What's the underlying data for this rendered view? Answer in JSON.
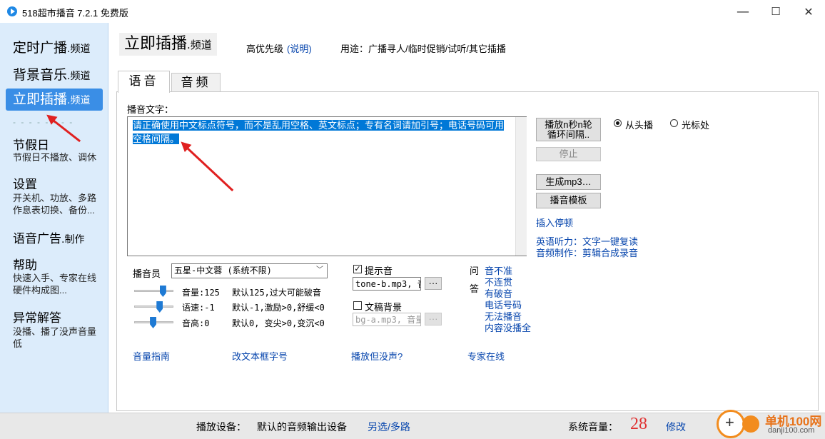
{
  "window": {
    "title": "518超市播音 7.2.1 免费版",
    "minimize_glyph": "—",
    "maximize_glyph": "☐",
    "close_glyph": "✕"
  },
  "sidebar": {
    "scheduled": {
      "main": "定时广播",
      "suffix": ".频道"
    },
    "bgm": {
      "main": "背景音乐",
      "suffix": ".频道"
    },
    "instant": {
      "main": "立即插播",
      "suffix": ".频道"
    },
    "separator": "- - - - - - - -",
    "holiday": {
      "title": "节假日",
      "desc": "节假日不播放、调休"
    },
    "settings": {
      "title": "设置",
      "desc": "开关机、功放、多路作息表切换、备份..."
    },
    "voice_ad": {
      "main": "语音广告",
      "suffix": ".制作"
    },
    "help": {
      "title": "帮助",
      "desc": "快速入手、专家在线硬件构成图..."
    },
    "trouble": {
      "title": "异常解答",
      "desc": "没播、播了没声音量低"
    }
  },
  "header": {
    "title": "立即插播",
    "title_suffix": ".频道",
    "priority": "高优先级",
    "priority_link": "(说明)",
    "usage": "用途：广播寻人/临时促销/试听/其它插播"
  },
  "tabs": [
    {
      "label": "语音"
    },
    {
      "label": "音频"
    }
  ],
  "voice": {
    "text_label": "播音文字：",
    "text_line1": "请正确使用中文标点符号，而不是乱用空格、英文标点；专有名词请加引号；电话号码可用",
    "text_line2": "空格间隔。",
    "loop_button": "播放n秒n轮\n循环间隔..",
    "stop_button": "停止",
    "mp3_button": "生成mp3…",
    "template_button": "播音模板",
    "insert_pause": "插入停顿",
    "radio_start": "从头播",
    "radio_cursor": "光标处",
    "english_link": "英语听力：文字一键复读",
    "audio_link": "音频制作：剪辑合成录音"
  },
  "announcer": {
    "label": "播音员",
    "selected": "五星-中文蓉 (系统不限)",
    "volume_label": "音量:125",
    "volume_hint": "默认125,过大可能破音",
    "speed_label": "语速:-1",
    "speed_hint": "默认-1,激励>0,舒缓<0",
    "pitch_label": "音高:0",
    "pitch_hint": "默认0, 变尖>0,变沉<0",
    "volume_level": 0.78,
    "speed_level": 0.68,
    "pitch_level": 0.48
  },
  "prompt_tone": {
    "label": "提示音",
    "checked": "✓",
    "file": "tone-b.mp3, 音",
    "browse": "···"
  },
  "bg_music": {
    "label": "文稿背景",
    "file": "bg-a.mp3, 音量",
    "browse": "···"
  },
  "qa": {
    "q": "问",
    "a": "答",
    "items": [
      "音不准",
      "不连贯",
      "有破音",
      "电话号码",
      "无法播音",
      "内容没播全"
    ]
  },
  "bottom_links": [
    "音量指南",
    "改文本框字号",
    "播放但没声?",
    "专家在线"
  ],
  "status": {
    "device_label": "播放设备：",
    "device": "默认的音频输出设备",
    "device_link": "另选/多路",
    "sys_volume_label": "系统音量：",
    "sys_volume": "28",
    "modify_link": "修改"
  },
  "watermark": {
    "name": "单机100网",
    "url": "danji100.com"
  },
  "colors": {
    "accent": "#3a8ee6",
    "link": "#0645ad",
    "selection": "#0078d7",
    "arrow": "#e02020",
    "volume_number": "#e03030"
  }
}
